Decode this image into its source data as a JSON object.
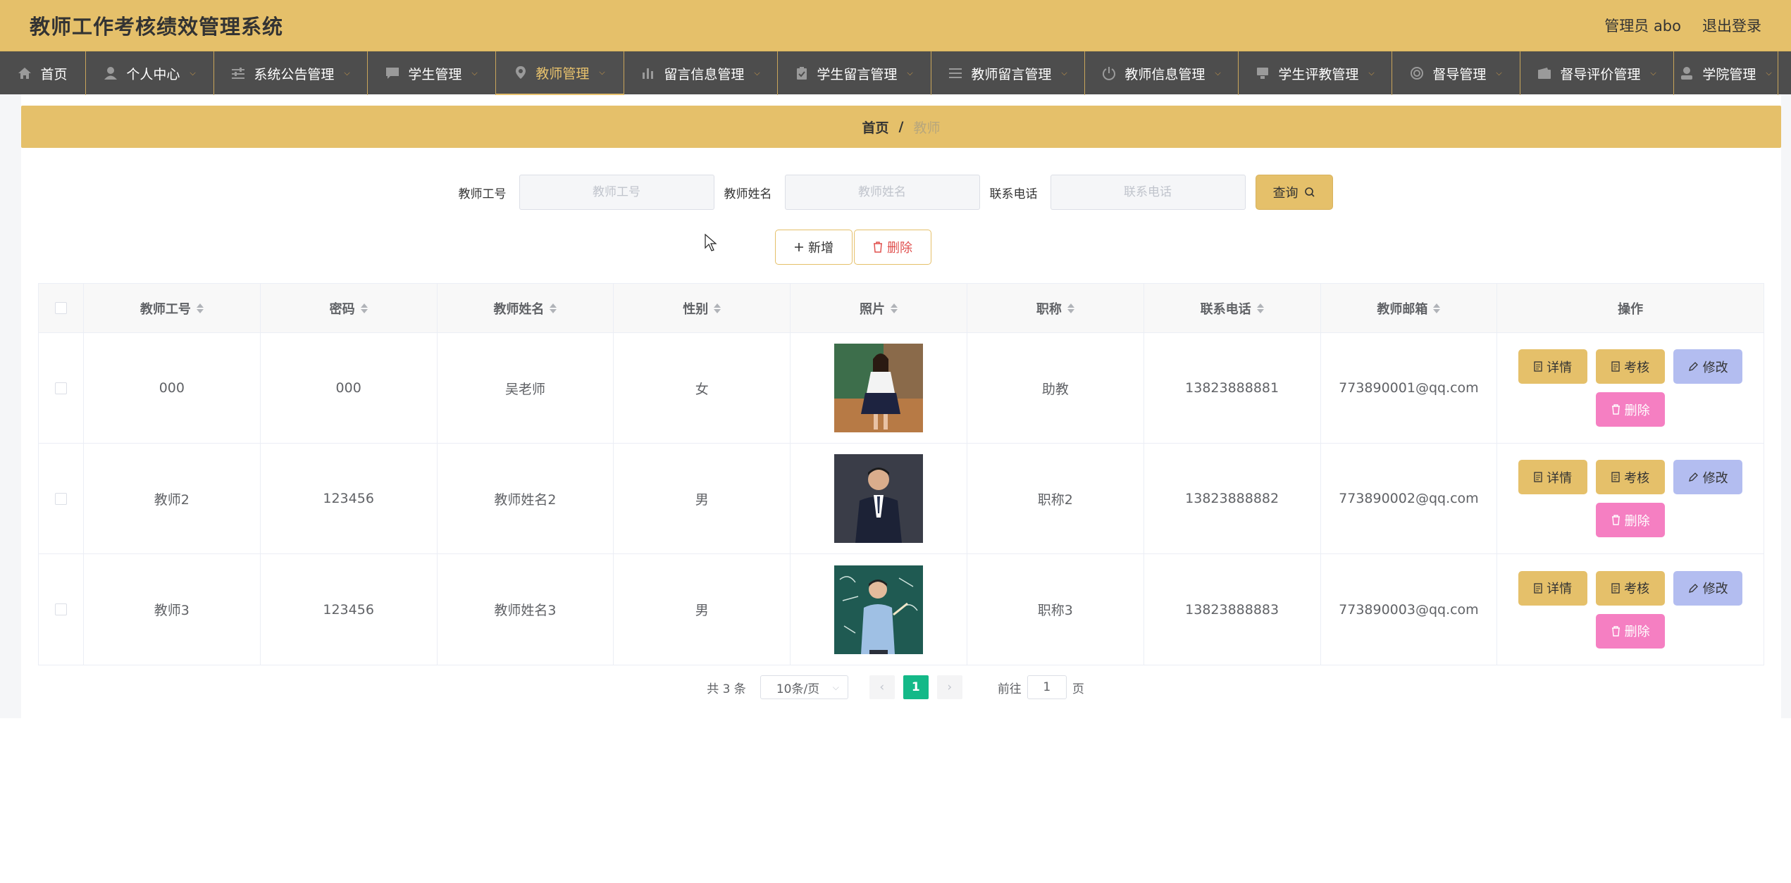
{
  "header": {
    "title": "教师工作考核绩效管理系统",
    "admin": "管理员 abo",
    "logout": "退出登录"
  },
  "nav": [
    {
      "label": "首页",
      "icon": "home-icon",
      "dropdown": false
    },
    {
      "label": "个人中心",
      "icon": "user-icon",
      "dropdown": true
    },
    {
      "label": "系统公告管理",
      "icon": "sliders-icon",
      "dropdown": true
    },
    {
      "label": "学生管理",
      "icon": "chat-icon",
      "dropdown": true
    },
    {
      "label": "教师管理",
      "icon": "location-icon",
      "dropdown": true,
      "active": true
    },
    {
      "label": "留言信息管理",
      "icon": "bar-chart-icon",
      "dropdown": true
    },
    {
      "label": "学生留言管理",
      "icon": "clipboard-icon",
      "dropdown": true
    },
    {
      "label": "教师留言管理",
      "icon": "menu-icon",
      "dropdown": true
    },
    {
      "label": "教师信息管理",
      "icon": "power-icon",
      "dropdown": true
    },
    {
      "label": "学生评教管理",
      "icon": "monitor-icon",
      "dropdown": true
    },
    {
      "label": "督导管理",
      "icon": "globe-icon",
      "dropdown": true
    },
    {
      "label": "督导评价管理",
      "icon": "wallet-icon",
      "dropdown": true
    },
    {
      "label": "学院管理",
      "icon": "person-icon",
      "dropdown": true
    }
  ],
  "breadcrumb": {
    "home": "首页",
    "sep": "/",
    "current": "教师"
  },
  "search": {
    "fields": [
      {
        "label": "教师工号",
        "placeholder": "教师工号"
      },
      {
        "label": "教师姓名",
        "placeholder": "教师姓名"
      },
      {
        "label": "联系电话",
        "placeholder": "联系电话"
      }
    ],
    "query_label": "查询"
  },
  "actions": {
    "add_label": "新增",
    "delete_label": "删除"
  },
  "table": {
    "columns": [
      "教师工号",
      "密码",
      "教师姓名",
      "性别",
      "照片",
      "职称",
      "联系电话",
      "教师邮箱",
      "操作"
    ],
    "rows": [
      {
        "id": "000",
        "password": "000",
        "name": "吴老师",
        "gender": "女",
        "title": "助教",
        "phone": "13823888881",
        "email": "773890001@qq.com"
      },
      {
        "id": "教师2",
        "password": "123456",
        "name": "教师姓名2",
        "gender": "男",
        "title": "职称2",
        "phone": "13823888882",
        "email": "773890002@qq.com"
      },
      {
        "id": "教师3",
        "password": "123456",
        "name": "教师姓名3",
        "gender": "男",
        "title": "职称3",
        "phone": "13823888883",
        "email": "773890003@qq.com"
      }
    ],
    "op_labels": {
      "detail": "详情",
      "review": "考核",
      "edit": "修改",
      "delete": "删除"
    }
  },
  "pagination": {
    "total": "共 3 条",
    "page_size": "10条/页",
    "current_page": "1",
    "goto_prefix": "前往",
    "goto_value": "1",
    "goto_suffix": "页"
  },
  "colors": {
    "accent": "#e5c06a",
    "nav_bg": "#4d4d4d",
    "edit": "#b3bdf0",
    "delete": "#f57fc2",
    "pager_active": "#14b988"
  }
}
